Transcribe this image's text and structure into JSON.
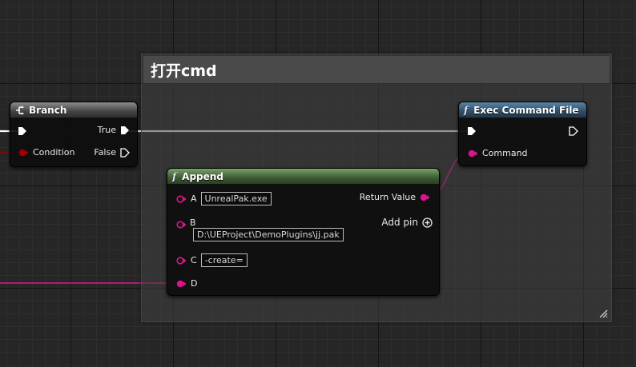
{
  "comment": {
    "title": "打开cmd"
  },
  "nodes": {
    "branch": {
      "title": "Branch",
      "pins": {
        "true_label": "True",
        "condition_label": "Condition",
        "false_label": "False"
      }
    },
    "exec_command": {
      "title": "Exec Command File",
      "pins": {
        "command_label": "Command"
      }
    },
    "append": {
      "title": "Append",
      "pins": {
        "a_label": "A",
        "a_value": "UnrealPak.exe",
        "b_label": "B",
        "b_value": "D:\\UEProject\\DemoPlugins\\jj.pak",
        "c_label": "C",
        "c_value": "-create=",
        "d_label": "D",
        "return_label": "Return Value",
        "add_pin_label": "Add pin"
      }
    }
  },
  "colors": {
    "exec_wire": "#ffffff",
    "string_pin": "#e0138c",
    "bool_pin": "#960000",
    "pure_function_header": "#4d6e40",
    "function_header": "#3c5c7a"
  },
  "icons": [
    "branch-icon",
    "function-icon",
    "exec-pin-icon",
    "string-pin-icon",
    "bool-pin-icon",
    "add-pin-icon",
    "resize-grip-icon"
  ]
}
